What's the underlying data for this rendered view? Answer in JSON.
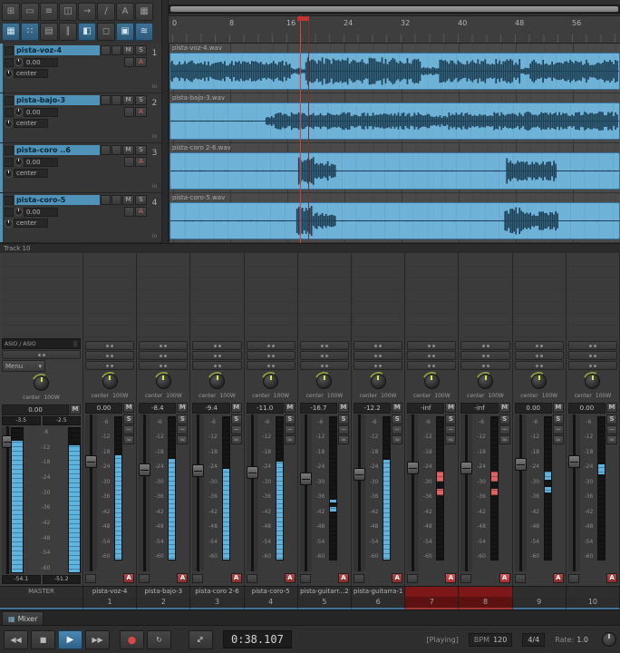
{
  "labels": {
    "mute": "M",
    "solo": "S",
    "arm": "A",
    "io": "io",
    "env1": "~",
    "env2": "≈"
  },
  "colors": {
    "accent": "#4f93b8",
    "meter_blue": "#5db4e0",
    "meter_red": "#df6464"
  },
  "toolbar": {
    "row1": [
      {
        "name": "grid-move-icon",
        "glyph": "⊞",
        "active": false
      },
      {
        "name": "item-edit-icon",
        "glyph": "▭",
        "active": false
      },
      {
        "name": "list-icon",
        "glyph": "≡",
        "active": false
      },
      {
        "name": "split-item-icon",
        "glyph": "◫",
        "active": false
      },
      {
        "name": "arrow-right-icon",
        "glyph": "→",
        "active": false
      },
      {
        "name": "razor-icon",
        "glyph": "∕",
        "active": false
      },
      {
        "name": "text-tool-icon",
        "glyph": "A",
        "active": false
      },
      {
        "name": "grid-icon",
        "glyph": "▦",
        "active": false
      }
    ],
    "row2": [
      {
        "name": "grid-snap-icon",
        "glyph": "▦",
        "active": true
      },
      {
        "name": "dots-grid-icon",
        "glyph": "∷",
        "active": true
      },
      {
        "name": "rows-icon",
        "glyph": "▤",
        "active": false
      },
      {
        "name": "bars-icon",
        "glyph": "∥",
        "active": false
      },
      {
        "name": "mixer-fader-icon",
        "glyph": "◧",
        "active": true
      },
      {
        "name": "lock-icon",
        "glyph": "◻",
        "active": false
      },
      {
        "name": "media-explorer-icon",
        "glyph": "▣",
        "active": true
      },
      {
        "name": "waveform-view-icon",
        "glyph": "≋",
        "active": true
      }
    ]
  },
  "ruler": {
    "ticks": [
      "0",
      "8",
      "16",
      "24",
      "32",
      "40",
      "48",
      "56"
    ]
  },
  "tracks": [
    {
      "num": "1",
      "name": "pista-voz-4",
      "vol": "0.00",
      "pan": "center",
      "clip": "pista-voz-4.wav"
    },
    {
      "num": "2",
      "name": "pista-bajo-3",
      "vol": "0.00",
      "pan": "center",
      "clip": "pista-bajo-3.wav"
    },
    {
      "num": "3",
      "name": "pista-coro ..6",
      "vol": "0.00",
      "pan": "center",
      "clip": "pista-coro 2-6.wav"
    },
    {
      "num": "4",
      "name": "pista-coro-5",
      "vol": "0.00",
      "pan": "center",
      "clip": "pista-coro-5.wav"
    }
  ],
  "status": {
    "track_label": "Track 10"
  },
  "mixer": {
    "io_label": "ASIO / ASIO",
    "menu_label": "Menu",
    "menu_caret": "▾",
    "pan_label": "center",
    "width_label": "100W",
    "scale": [
      "-6",
      "-12",
      "-18",
      "-24",
      "-30",
      "-36",
      "-42",
      "-48",
      "-54",
      "-60"
    ],
    "master": {
      "name": "MASTER",
      "vol": "0.00",
      "peak_l": "-3.5",
      "peak_r": "-2.5",
      "rms_l": "-54.1",
      "rms_r": "-51.2",
      "meter_l": "0:91",
      "meter_r": "0:88",
      "fader": "6%"
    },
    "channels": [
      {
        "num": "1",
        "name": "pista-voz-4",
        "vol": "0.00",
        "meter": "0:73",
        "fader": "26%",
        "armed": false
      },
      {
        "num": "2",
        "name": "pista-bajo-3",
        "vol": "-8.4",
        "meter": "0:71",
        "fader": "31%",
        "armed": false
      },
      {
        "num": "3",
        "name": "pista-coro 2-6",
        "vol": "-9.4",
        "meter": "0:64",
        "fader": "32%",
        "armed": false
      },
      {
        "num": "4",
        "name": "pista-coro-5",
        "vol": "-11.0",
        "meter": "0:69",
        "fader": "33%",
        "armed": false
      },
      {
        "num": "5",
        "name": "pista-guitarr...2",
        "vol": "-16.7",
        "meter": "34:3,40:2",
        "fader": "37%",
        "armed": false
      },
      {
        "num": "6",
        "name": "pista-guitarra-1",
        "vol": "-12.2",
        "meter": "0:70",
        "fader": "34%",
        "armed": false
      },
      {
        "num": "7",
        "name": "",
        "vol": "-inf",
        "meter": "55:7,45:5",
        "fader": "30%",
        "armed": true
      },
      {
        "num": "8",
        "name": "",
        "vol": "-inf",
        "meter": "55:7,45:5",
        "fader": "30%",
        "armed": true
      },
      {
        "num": "9",
        "name": "",
        "vol": "0.00",
        "meter": "56:6,47:4",
        "fader": "28%",
        "armed": false
      },
      {
        "num": "10",
        "name": "",
        "vol": "0.00",
        "meter": "60:7",
        "fader": "26%",
        "armed": false
      }
    ]
  },
  "tabs": {
    "mixer_label": "Mixer",
    "mixer_icon": "▦"
  },
  "transport": {
    "time": "0:38.107",
    "status": "[Playing]",
    "bpm_label": "BPM",
    "bpm_value": "120",
    "timesig": "4/4",
    "rate_label": "Rate:",
    "rate_value": "1.0",
    "buttons": {
      "start": "◀◀",
      "stop": "■",
      "play": "▶",
      "end": "▶▶",
      "record": "●",
      "repeat": "↻",
      "fit": "↔"
    }
  }
}
